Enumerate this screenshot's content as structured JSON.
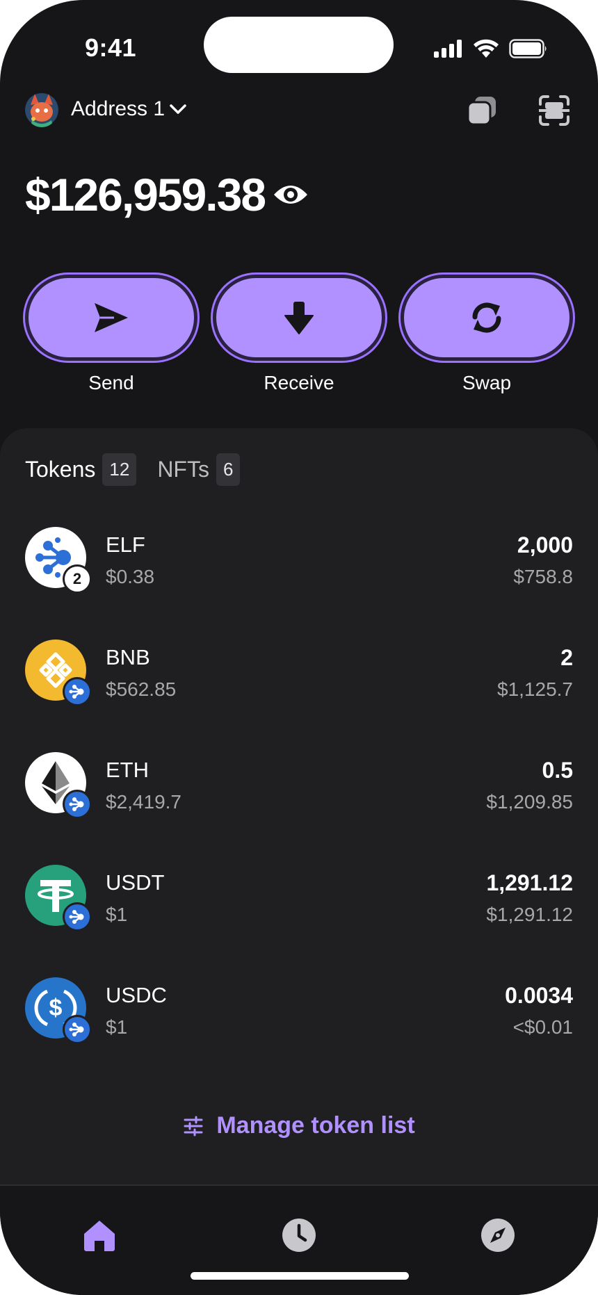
{
  "status_bar": {
    "time": "9:41"
  },
  "header": {
    "address_label": "Address 1"
  },
  "balance": {
    "value": "$126,959.38"
  },
  "actions": [
    {
      "label": "Send",
      "icon": "send-icon"
    },
    {
      "label": "Receive",
      "icon": "arrow-down-icon"
    },
    {
      "label": "Swap",
      "icon": "swap-icon"
    }
  ],
  "tabs": [
    {
      "label": "Tokens",
      "count": "12",
      "active": true
    },
    {
      "label": "NFTs",
      "count": "6",
      "active": false
    }
  ],
  "tokens": [
    {
      "symbol": "ELF",
      "price": "$0.38",
      "amount": "2,000",
      "value": "$758.8",
      "badge": "2",
      "icon": "elf-logo-icon"
    },
    {
      "symbol": "BNB",
      "price": "$562.85",
      "amount": "2",
      "value": "$1,125.7",
      "icon": "bnb-logo-icon"
    },
    {
      "symbol": "ETH",
      "price": "$2,419.7",
      "amount": "0.5",
      "value": "$1,209.85",
      "icon": "eth-logo-icon"
    },
    {
      "symbol": "USDT",
      "price": "$1",
      "amount": "1,291.12",
      "value": "$1,291.12",
      "icon": "usdt-logo-icon"
    },
    {
      "symbol": "USDC",
      "price": "$1",
      "amount": "0.0034",
      "value": "<$0.01",
      "icon": "usdc-logo-icon"
    }
  ],
  "manage": {
    "label": "Manage token list"
  },
  "colors": {
    "accent": "#b191ff",
    "background": "#161518",
    "panel": "#1f1e21"
  },
  "nav": [
    {
      "name": "home",
      "icon": "home-icon",
      "active": true
    },
    {
      "name": "history",
      "icon": "clock-icon",
      "active": false
    },
    {
      "name": "explore",
      "icon": "compass-icon",
      "active": false
    }
  ]
}
